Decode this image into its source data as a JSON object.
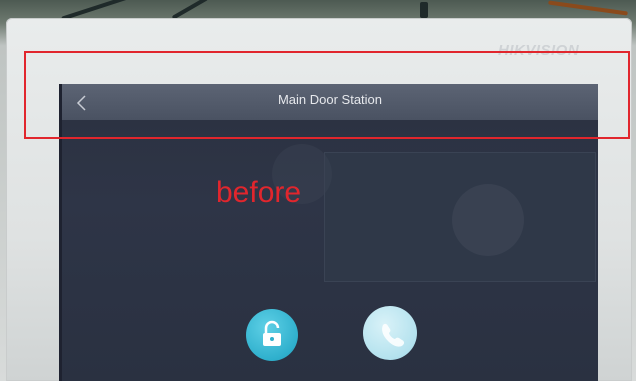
{
  "brand": {
    "logo_text": "HIKVISION"
  },
  "screen": {
    "title": "Main Door Station",
    "back_icon": "chevron-left-icon",
    "buttons": [
      {
        "name": "unlock",
        "icon": "unlock-icon",
        "color": "#2fb0cd"
      },
      {
        "name": "call",
        "icon": "phone-icon",
        "color": "#b4e2ee"
      }
    ]
  },
  "annotation": {
    "label": "before",
    "color": "#e1262d"
  }
}
